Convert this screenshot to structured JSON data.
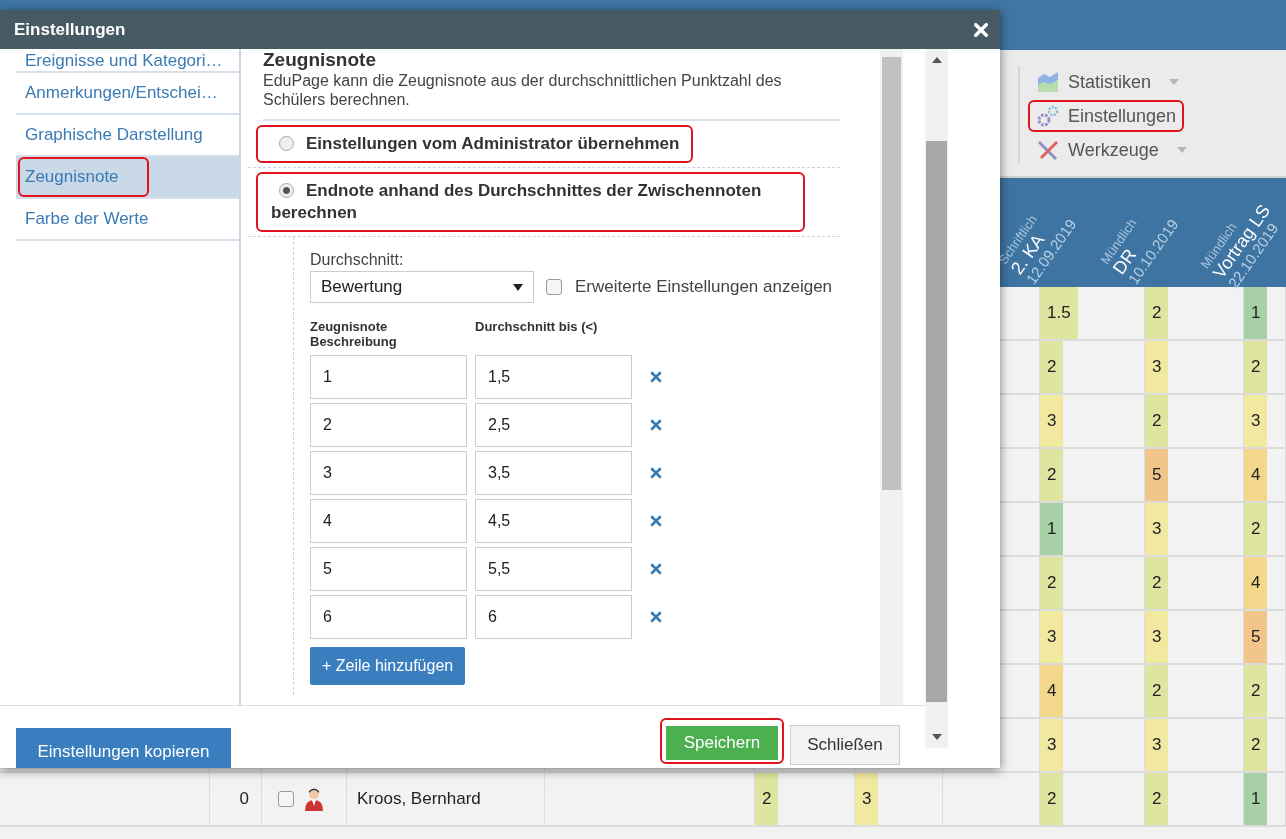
{
  "toolbar": [
    {
      "label": "Statistiken",
      "dropdown": true,
      "annotated": false
    },
    {
      "label": "Einstellungen",
      "dropdown": false,
      "annotated": true
    },
    {
      "label": "Werkzeuge",
      "dropdown": true,
      "annotated": false
    }
  ],
  "columns": [
    {
      "type": "Schriftlich",
      "title": "2. KA",
      "date": "12.09.2019"
    },
    {
      "type": "Mündlich",
      "title": "DR",
      "date": "10.10.2019"
    },
    {
      "type": "Mündlich",
      "title": "Vortrag LS",
      "date": "22.10.2019"
    }
  ],
  "rows": [
    {
      "grades": [
        "1.5",
        "2",
        "1"
      ]
    },
    {
      "grades": [
        "2",
        "3",
        "2"
      ]
    },
    {
      "grades": [
        "3",
        "2",
        "3"
      ]
    },
    {
      "grades": [
        "2",
        "5",
        "4"
      ]
    },
    {
      "grades": [
        "1",
        "3",
        "2"
      ]
    },
    {
      "grades": [
        "2",
        "2",
        "4"
      ]
    },
    {
      "grades": [
        "3",
        "3",
        "5"
      ]
    },
    {
      "grades": [
        "4",
        "2",
        "2"
      ]
    },
    {
      "grades": [
        "3",
        "3",
        "2"
      ]
    }
  ],
  "student": {
    "number": "0",
    "checked": false,
    "name": "Kroos, Bernhard",
    "early_grades": [
      "2",
      "3"
    ],
    "grades": [
      "2",
      "2",
      "1"
    ]
  },
  "dialog": {
    "title": "Einstellungen",
    "sidebar": [
      {
        "label": "Ereignisse und Kategori…",
        "selected": false,
        "annotated": false
      },
      {
        "label": "Anmerkungen/Entschei…",
        "selected": false,
        "annotated": false
      },
      {
        "label": "Graphische Darstellung",
        "selected": false,
        "annotated": false
      },
      {
        "label": "Zeugnisnote",
        "selected": true,
        "annotated": true
      },
      {
        "label": "Farbe der Werte",
        "selected": false,
        "annotated": false
      }
    ],
    "heading": "Zeugnisnote",
    "description": "EduPage kann die Zeugnisnote aus der durchschnittlichen Punktzahl des Schülers berechnen.",
    "options": [
      {
        "label": "Einstellungen vom Administrator übernehmen",
        "selected": false,
        "annotated": true
      },
      {
        "label": "Endnote anhand des Durchschnittes der Zwischennoten berechnen",
        "selected": true,
        "annotated": true
      }
    ],
    "average_label": "Durchschnitt:",
    "average_select": "Bewertung",
    "advanced": {
      "label": "Erweiterte Einstellungen anzeigen",
      "checked": false
    },
    "table_columns": [
      "Zeugnisnote Beschreibung",
      "Durchschnitt bis (<)"
    ],
    "table_rows": [
      {
        "grade": "1",
        "until": "1,5"
      },
      {
        "grade": "2",
        "until": "2,5"
      },
      {
        "grade": "3",
        "until": "3,5"
      },
      {
        "grade": "4",
        "until": "4,5"
      },
      {
        "grade": "5",
        "until": "5,5"
      },
      {
        "grade": "6",
        "until": "6"
      }
    ],
    "add_button": "+ Zeile hinzufügen",
    "copy_button": "Einstellungen kopieren",
    "save_button": {
      "label": "Speichern",
      "annotated": true
    },
    "close_button": "Schließen"
  }
}
